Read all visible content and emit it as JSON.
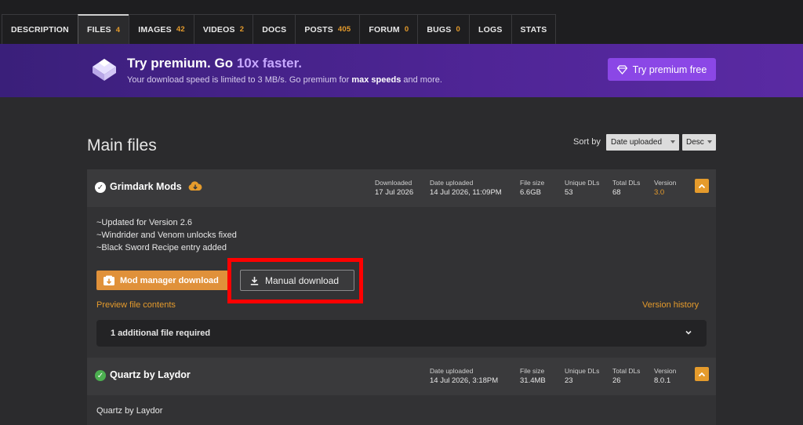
{
  "tabs": [
    {
      "label": "DESCRIPTION",
      "count": ""
    },
    {
      "label": "FILES",
      "count": "4"
    },
    {
      "label": "IMAGES",
      "count": "42"
    },
    {
      "label": "VIDEOS",
      "count": "2"
    },
    {
      "label": "DOCS",
      "count": ""
    },
    {
      "label": "POSTS",
      "count": "405"
    },
    {
      "label": "FORUM",
      "count": "0"
    },
    {
      "label": "BUGS",
      "count": "0"
    },
    {
      "label": "LOGS",
      "count": ""
    },
    {
      "label": "STATS",
      "count": ""
    }
  ],
  "banner": {
    "title_prefix": "Try premium. Go ",
    "title_accent": "10x faster.",
    "subtitle_prefix": "Your download speed is limited to 3 MB/s. Go premium for ",
    "subtitle_bold": "max speeds",
    "subtitle_suffix": " and more.",
    "button_label": "Try premium free"
  },
  "main": {
    "title": "Main files",
    "sort_label": "Sort by",
    "sort_value": "Date uploaded",
    "sort_dir": "Desc"
  },
  "file1": {
    "name": "Grimdark Mods",
    "downloaded_label": "Downloaded",
    "downloaded_value": "17 Jul 2026",
    "date_label": "Date uploaded",
    "date_value": "14 Jul 2026, 11:09PM",
    "size_label": "File size",
    "size_value": "6.6GB",
    "unique_label": "Unique DLs",
    "unique_value": "53",
    "total_label": "Total DLs",
    "total_value": "68",
    "version_label": "Version",
    "version_value": "3.0",
    "desc_lines": [
      "~Updated for Version 2.6",
      "~Windrider and Venom unlocks fixed",
      "~Black Sword Recipe entry added"
    ],
    "mod_manager_label": "Mod manager download",
    "manual_label": "Manual download",
    "preview_label": "Preview file contents",
    "history_label": "Version history",
    "required_label": "1 additional file required"
  },
  "file2": {
    "name": "Quartz by Laydor",
    "date_label": "Date uploaded",
    "date_value": "14 Jul 2026, 3:18PM",
    "size_label": "File size",
    "size_value": "31.4MB",
    "unique_label": "Unique DLs",
    "unique_value": "23",
    "total_label": "Total DLs",
    "total_value": "26",
    "version_label": "Version",
    "version_value": "8.0.1",
    "desc": "Quartz by Laydor"
  },
  "colors": {
    "accent": "#e59b2c",
    "premium": "#8b47e6",
    "highlight": "#ff0000"
  }
}
